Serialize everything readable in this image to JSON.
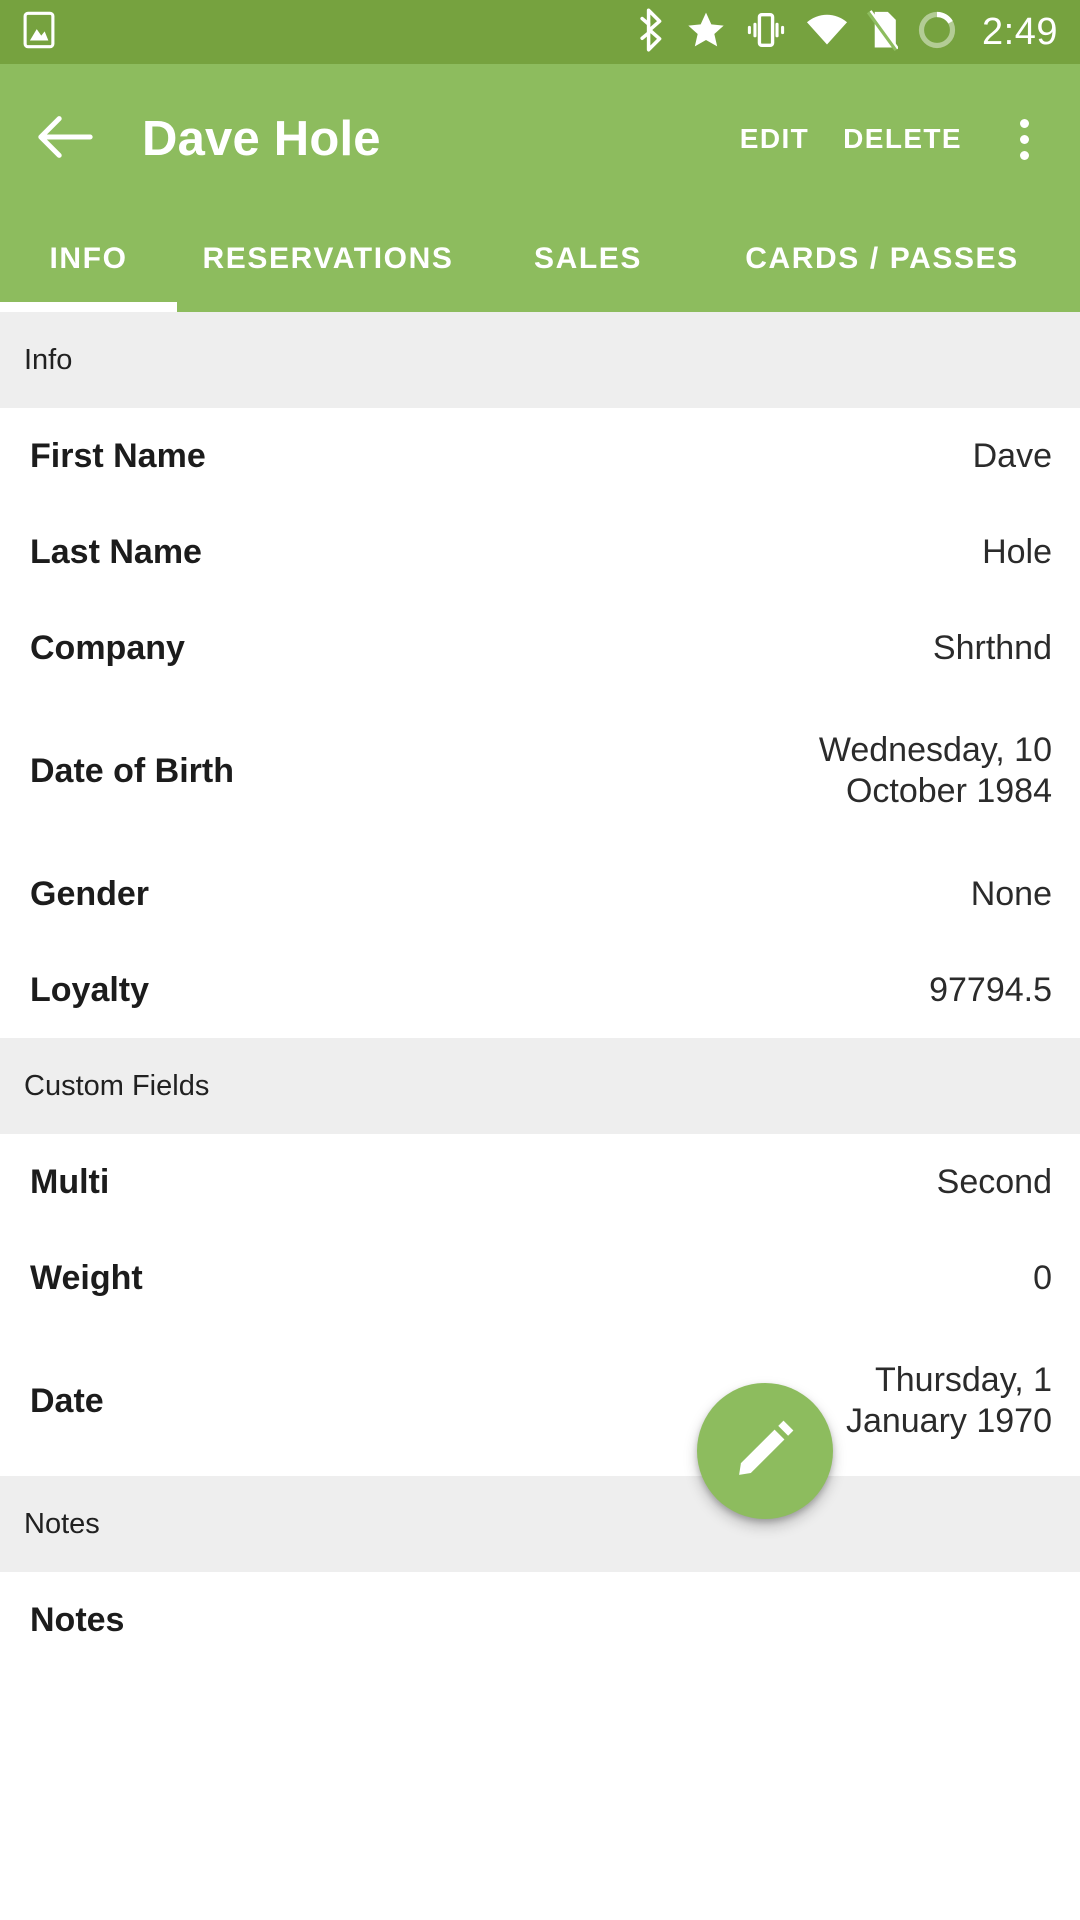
{
  "statusbar": {
    "left_icons": [
      "image-icon"
    ],
    "right_icons": [
      "bluetooth-icon",
      "star-icon",
      "vibrate-icon",
      "wifi-icon",
      "no-sim-icon",
      "battery-icon"
    ],
    "time": "2:49"
  },
  "appbar": {
    "back_label": "back-arrow",
    "title": "Dave Hole",
    "edit_label": "EDIT",
    "delete_label": "DELETE",
    "overflow_label": "more-options"
  },
  "tabs": [
    {
      "label": "INFO",
      "active": true
    },
    {
      "label": "RESERVATIONS",
      "active": false
    },
    {
      "label": "SALES",
      "active": false
    },
    {
      "label": "CARDS / PASSES",
      "active": false
    }
  ],
  "sections": [
    {
      "header": "Info",
      "rows": [
        {
          "label": "First Name",
          "value": "Dave"
        },
        {
          "label": "Last Name",
          "value": "Hole"
        },
        {
          "label": "Company",
          "value": "Shrthnd"
        },
        {
          "label": "Date of Birth",
          "value": "Wednesday, 10 October 1984",
          "tall": true
        },
        {
          "label": "Gender",
          "value": "None"
        },
        {
          "label": "Loyalty",
          "value": "97794.5"
        }
      ]
    },
    {
      "header": "Custom Fields",
      "rows": [
        {
          "label": "Multi",
          "value": "Second"
        },
        {
          "label": "Weight",
          "value": "0"
        },
        {
          "label": "Date",
          "value": "Thursday, 1 January 1970",
          "tall": true
        }
      ]
    },
    {
      "header": "Notes",
      "rows": [
        {
          "label": "Notes",
          "value": ""
        }
      ]
    }
  ],
  "fab": {
    "icon": "pencil-icon"
  },
  "colors": {
    "statusbar_green": "#76a23f",
    "appbar_green": "#8dbc5e",
    "section_gray": "#eeeeee",
    "row_white": "#ffffff",
    "text_dark": "#1c1c1c",
    "text_on_green": "#ffffff"
  }
}
